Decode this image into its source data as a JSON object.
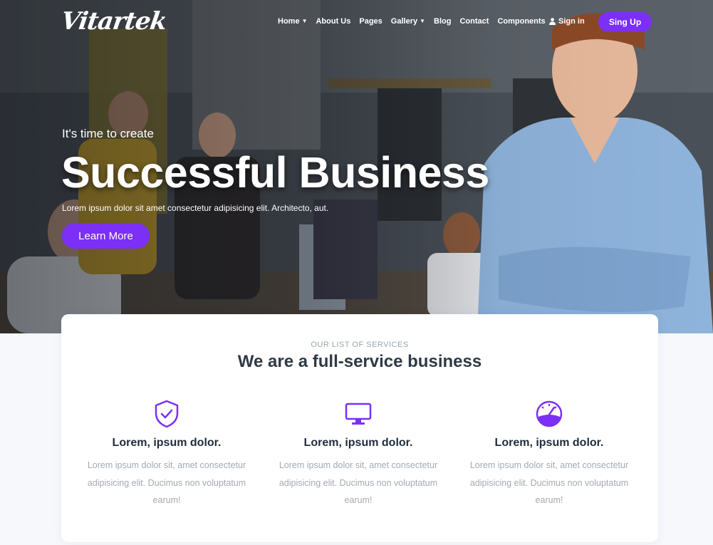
{
  "brand": {
    "logo_text": "Vitartek",
    "accent": "#7b2ff7"
  },
  "nav": {
    "items": [
      {
        "label": "Home",
        "has_dropdown": true
      },
      {
        "label": "About Us",
        "has_dropdown": false
      },
      {
        "label": "Pages",
        "has_dropdown": false
      },
      {
        "label": "Gallery",
        "has_dropdown": true
      },
      {
        "label": "Blog",
        "has_dropdown": false
      },
      {
        "label": "Contact",
        "has_dropdown": false
      },
      {
        "label": "Components",
        "has_dropdown": false
      }
    ],
    "sign_in": "Sign in",
    "sign_up": "Sing Up"
  },
  "hero": {
    "eyebrow": "It's time to create",
    "headline": "Successful Business",
    "lead": "Lorem ipsum dolor sit amet consectetur adipisicing elit. Architecto, aut.",
    "cta": "Learn More"
  },
  "services": {
    "kicker": "OUR LIST OF SERVICES",
    "title": "We are a full-service business",
    "items": [
      {
        "icon": "shield-check-icon",
        "title": "Lorem, ipsum dolor.",
        "text": "Lorem ipsum dolor sit, amet consectetur adipisicing elit. Ducimus non voluptatum earum!"
      },
      {
        "icon": "monitor-icon",
        "title": "Lorem, ipsum dolor.",
        "text": "Lorem ipsum dolor sit, amet consectetur adipisicing elit. Ducimus non voluptatum earum!"
      },
      {
        "icon": "speedometer-icon",
        "title": "Lorem, ipsum dolor.",
        "text": "Lorem ipsum dolor sit, amet consectetur adipisicing elit. Ducimus non voluptatum earum!"
      }
    ]
  }
}
